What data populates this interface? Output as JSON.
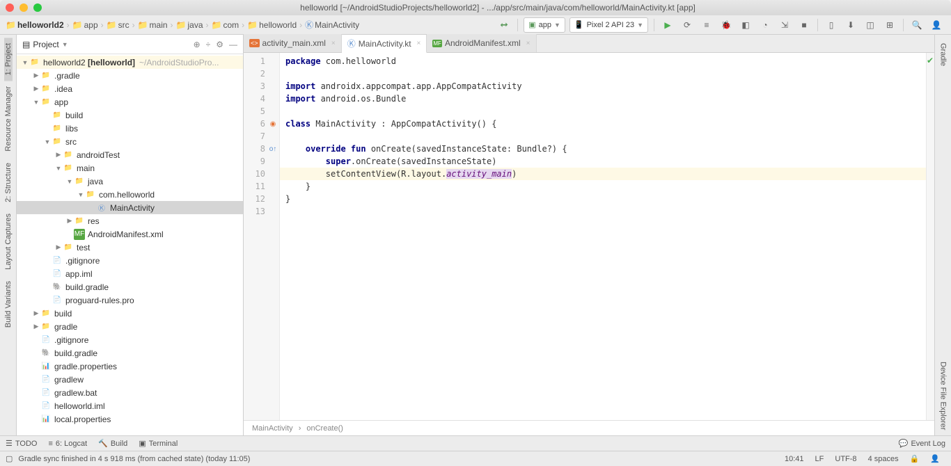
{
  "window": {
    "title": "helloworld [~/AndroidStudioProjects/helloworld2] - .../app/src/main/java/com/helloworld/MainActivity.kt [app]"
  },
  "breadcrumb": [
    "helloworld2",
    "app",
    "src",
    "main",
    "java",
    "com",
    "helloworld",
    "MainActivity"
  ],
  "toolbar": {
    "config": "app",
    "device": "Pixel 2 API 23"
  },
  "left_rail": [
    "1: Project",
    "Resource Manager",
    "2: Structure",
    "Layout Captures",
    "Build Variants"
  ],
  "right_rail": [
    "Gradle",
    "Device File Explorer"
  ],
  "project_panel": {
    "title": "Project"
  },
  "tree": {
    "root": {
      "name": "helloworld2",
      "bold": "[helloworld]",
      "hint": "~/AndroidStudioPro..."
    },
    "items": [
      ".gradle",
      ".idea",
      "app",
      "build",
      "libs",
      "src",
      "androidTest",
      "main",
      "java",
      "com.helloworld",
      "MainActivity",
      "res",
      "AndroidManifest.xml",
      "test",
      ".gitignore",
      "app.iml",
      "build.gradle",
      "proguard-rules.pro",
      "build",
      "gradle",
      ".gitignore",
      "build.gradle",
      "gradle.properties",
      "gradlew",
      "gradlew.bat",
      "helloworld.iml",
      "local.properties"
    ]
  },
  "tabs": [
    {
      "label": "activity_main.xml",
      "active": false
    },
    {
      "label": "MainActivity.kt",
      "active": true
    },
    {
      "label": "AndroidManifest.xml",
      "active": false
    }
  ],
  "code": {
    "lines": [
      {
        "n": 1,
        "html": "<span class='kw'>package</span> com.helloworld"
      },
      {
        "n": 2,
        "html": ""
      },
      {
        "n": 3,
        "html": "<span class='kw'>import</span> androidx.appcompat.app.AppCompatActivity"
      },
      {
        "n": 4,
        "html": "<span class='kw'>import</span> android.os.Bundle"
      },
      {
        "n": 5,
        "html": ""
      },
      {
        "n": 6,
        "html": "<span class='kw'>class</span> MainActivity : AppCompatActivity() {"
      },
      {
        "n": 7,
        "html": ""
      },
      {
        "n": 8,
        "html": "    <span class='kw'>override fun</span> onCreate(savedInstanceState: Bundle?) {"
      },
      {
        "n": 9,
        "html": "        <span class='kw'>super</span>.onCreate(savedInstanceState)"
      },
      {
        "n": 10,
        "html": "        setContentView(R.layout.<span class='it highlight-purple'>activity_main</span>)",
        "hl": true
      },
      {
        "n": 11,
        "html": "    }"
      },
      {
        "n": 12,
        "html": "}"
      },
      {
        "n": 13,
        "html": ""
      }
    ]
  },
  "editor_crumb": [
    "MainActivity",
    "onCreate()"
  ],
  "bottom": {
    "todo": "TODO",
    "logcat": "6: Logcat",
    "build": "Build",
    "terminal": "Terminal",
    "eventlog": "Event Log"
  },
  "status": {
    "msg": "Gradle sync finished in 4 s 918 ms (from cached state) (today 11:05)",
    "time": "10:41",
    "le": "LF",
    "enc": "UTF-8",
    "indent": "4 spaces"
  }
}
